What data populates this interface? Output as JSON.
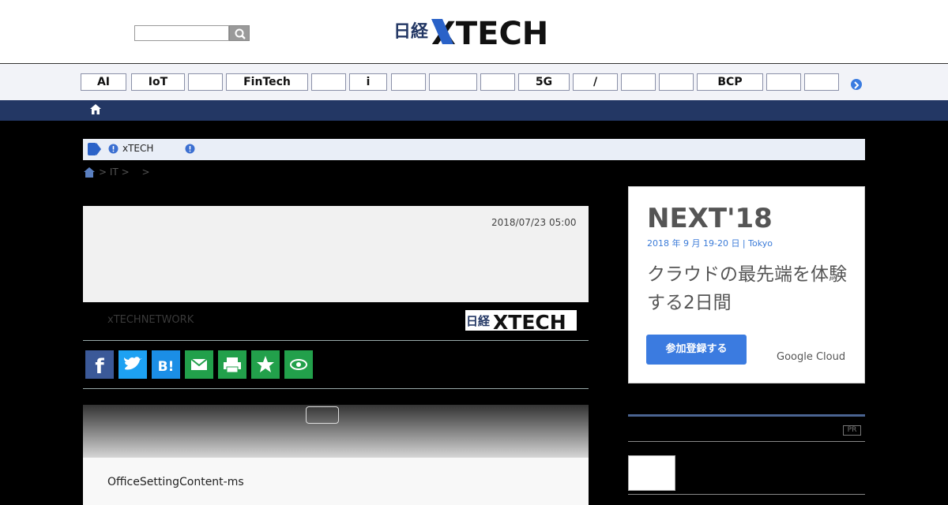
{
  "header": {
    "logo_text": "日経 XTECH",
    "search": {
      "placeholder": ""
    }
  },
  "tags": [
    "AI",
    "IoT",
    "",
    "FinTech",
    "",
    "i",
    "",
    "",
    "",
    "5G",
    "/",
    "",
    "",
    "BCP",
    "",
    ""
  ],
  "notice": {
    "text": "xTECH"
  },
  "breadcrumb": [
    ">",
    "IT",
    ">",
    ">"
  ],
  "article": {
    "date": "2018/07/23 05:00",
    "network_label": "xTECHNETWORK",
    "body_start": "OfficeSettingContent-ms"
  },
  "share_buttons": [
    {
      "name": "facebook",
      "color": "#3b5998"
    },
    {
      "name": "twitter",
      "color": "#1da1f2"
    },
    {
      "name": "hatena",
      "color": "#1b8ee6"
    },
    {
      "name": "mail",
      "color": "#22a04b"
    },
    {
      "name": "print",
      "color": "#22a04b"
    },
    {
      "name": "favorite",
      "color": "#22a04b"
    },
    {
      "name": "view",
      "color": "#22a04b"
    }
  ],
  "ad": {
    "title": "NEXT'18",
    "date": "2018 年 9 月 19-20 日 | Tokyo",
    "copy": "クラウドの最先端を体験する2日間",
    "button": "参加登録する",
    "brand": "Google Cloud"
  },
  "sidebar": {
    "pr_label": "PR"
  },
  "colors": {
    "nav": "#233764",
    "accent": "#3b7be0"
  }
}
